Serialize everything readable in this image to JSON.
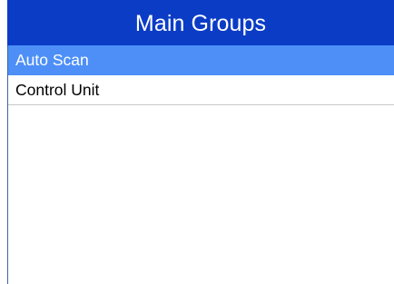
{
  "title": "Main Groups",
  "menu": {
    "items": [
      {
        "label": "Auto Scan",
        "selected": true
      },
      {
        "label": "Control Unit",
        "selected": false
      }
    ]
  },
  "colors": {
    "title_bar": "#0b3cc6",
    "selection": "#4d8ff7",
    "divider": "#c8c8c8"
  }
}
